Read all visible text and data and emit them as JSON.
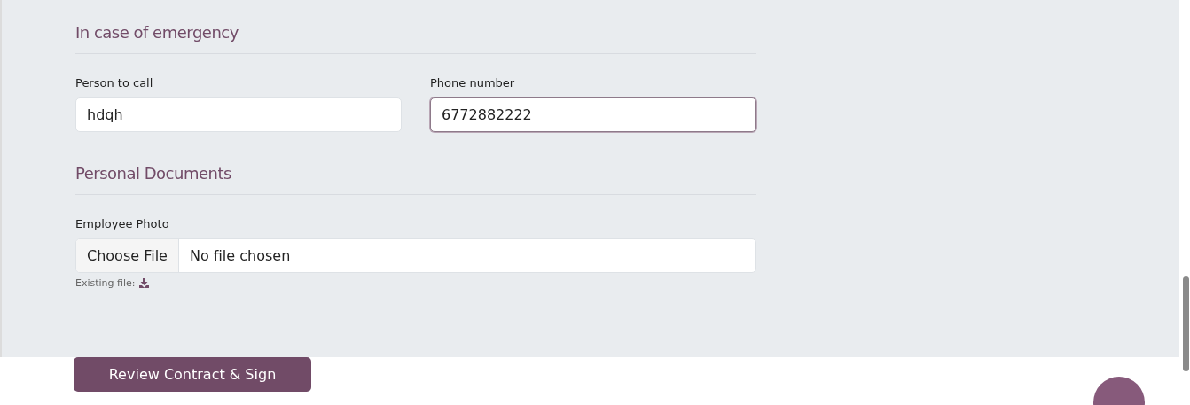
{
  "emergency": {
    "heading": "In case of emergency",
    "fields": [
      {
        "label": "Person to call",
        "value": "hdqh",
        "focused": false
      },
      {
        "label": "Phone number",
        "value": "6772882222",
        "focused": true
      }
    ]
  },
  "documents": {
    "heading": "Personal Documents",
    "photo": {
      "label": "Employee Photo",
      "button": "Choose File",
      "status": "No file chosen",
      "hint": "Existing file:"
    }
  },
  "submit_button": "Review Contract & Sign"
}
